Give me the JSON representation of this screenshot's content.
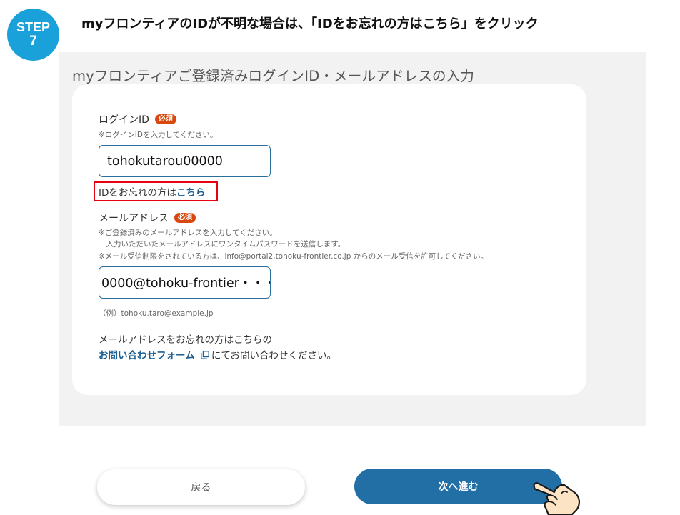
{
  "step": {
    "word": "STEP",
    "number": "7",
    "color": "#1ba1d9"
  },
  "headline": "myフロンティアのIDが不明な場合は、「IDをお忘れの方はこちら」をクリック",
  "form": {
    "title": "myフロンティアご登録済みログインID・メールアドレスの入力",
    "login_id": {
      "label": "ログインID",
      "required_badge": "必須",
      "note": "※ログインIDを入力してください。",
      "value": "tohokutarou00000"
    },
    "forgot_id": {
      "text": "IDをお忘れの方は",
      "link": "こちら",
      "highlight_color": "#e60012"
    },
    "email": {
      "label": "メールアドレス",
      "required_badge": "必須",
      "notes": [
        "※ご登録済みのメールアドレスを入力してください。",
        "　入力いただいたメールアドレスにワンタイムパスワードを送信します。",
        "※メール受信制限をされている方は、info@portal2.tohoku-frontier.co.jp からのメール受信を許可してください。"
      ],
      "value": "0000@tohoku-frontier・・・",
      "example": "（例）tohoku.taro@example.jp"
    },
    "contact": {
      "line1": "メールアドレスをお忘れの方はこちらの",
      "link": "お問い合わせフォーム",
      "line2_suffix": "にてお問い合わせください。",
      "link_icon": "external-window-icon"
    }
  },
  "buttons": {
    "back": "戻る",
    "next": "次へ進む",
    "next_color": "#226fa6"
  },
  "pointer_icon": "pointing-hand-icon"
}
